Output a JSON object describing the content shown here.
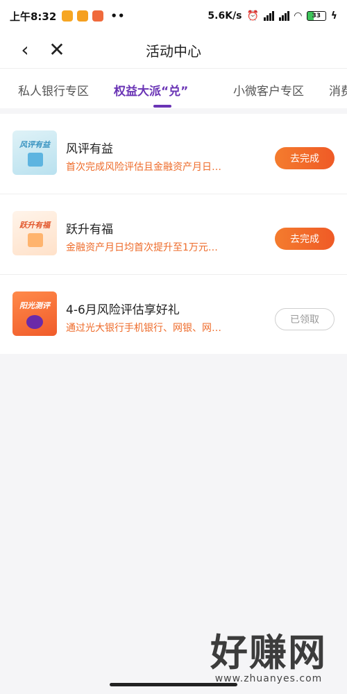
{
  "status": {
    "time": "上午8:32",
    "dots": "••",
    "speed": "5.6K/s",
    "battery": "33"
  },
  "nav": {
    "back": "‹",
    "close": "✕",
    "title": "活动中心"
  },
  "tabs": [
    {
      "label": "私人银行专区"
    },
    {
      "label": "权益大派“兑”"
    },
    {
      "label": "小微客户专区"
    },
    {
      "label": "消费"
    }
  ],
  "items": [
    {
      "thumb_text": "风评有益",
      "title": "风评有益",
      "desc": "首次完成风险评估且金融资产月日…",
      "action": "去完成"
    },
    {
      "thumb_text": "跃升有福",
      "title": "跃升有福",
      "desc": "金融资产月日均首次提升至1万元…",
      "action": "去完成"
    },
    {
      "thumb_text": "阳光测评",
      "title": "4-6月风险评估享好礼",
      "desc": "通过光大银行手机银行、网银、网…",
      "action": "已领取"
    }
  ],
  "watermark": {
    "main": "好赚网",
    "url": "www.zhuanyes.com"
  },
  "colors": {
    "accent": "#6a34b5",
    "orange": "#ef5a26",
    "desc": "#ee6b2a"
  }
}
